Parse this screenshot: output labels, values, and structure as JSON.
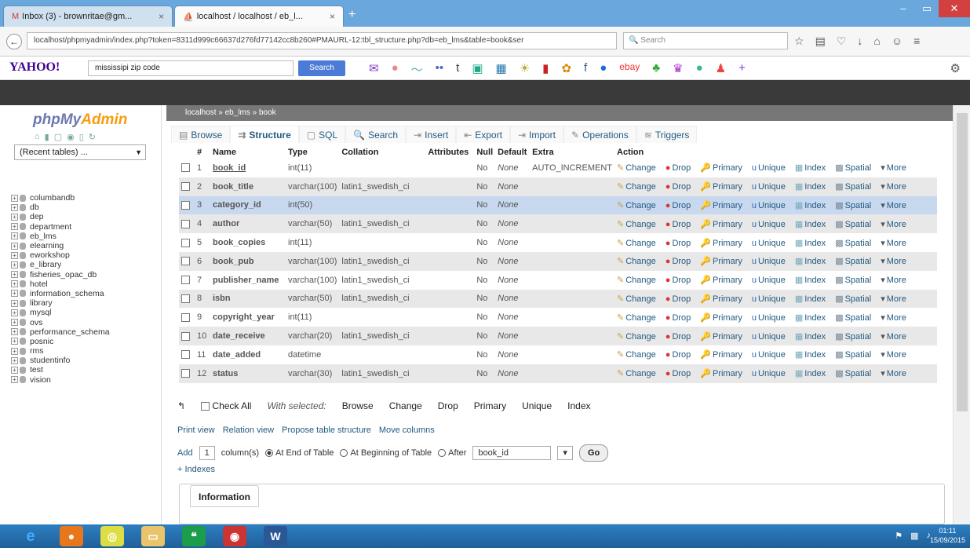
{
  "browser": {
    "tabs": [
      {
        "label": "Inbox (3) - brownritae@gm..."
      },
      {
        "label": "localhost / localhost / eb_l..."
      }
    ],
    "url": "localhost/phpmyadmin/index.php?token=8311d999c66637d276fd77142cc8b260#PMAURL-12:tbl_structure.php?db=eb_lms&table=book&ser",
    "search_placeholder": "Search"
  },
  "yahoo": {
    "logo": "YAHOO!",
    "query": "mississipi zip code",
    "search_button": "Search"
  },
  "sidebar": {
    "logo_php": "phpMy",
    "logo_admin": "Admin",
    "recent": "(Recent tables) ...",
    "databases": [
      "columbandb",
      "db",
      "dep",
      "department",
      "eb_lms",
      "elearning",
      "eworkshop",
      "e_library",
      "fisheries_opac_db",
      "hotel",
      "information_schema",
      "library",
      "mysql",
      "ovs",
      "performance_schema",
      "posnic",
      "rms",
      "studentinfo",
      "test",
      "vision"
    ]
  },
  "breadcrumb": "localhost » eb_lms » book",
  "tabs": [
    "Browse",
    "Structure",
    "SQL",
    "Search",
    "Insert",
    "Export",
    "Import",
    "Operations",
    "Triggers"
  ],
  "columns": {
    "hash": "#",
    "name": "Name",
    "type": "Type",
    "collation": "Collation",
    "attributes": "Attributes",
    "null": "Null",
    "default": "Default",
    "extra": "Extra",
    "action": "Action"
  },
  "rows": [
    {
      "n": "1",
      "name": "book_id",
      "type": "int(11)",
      "collation": "",
      "null": "No",
      "default": "None",
      "extra": "AUTO_INCREMENT"
    },
    {
      "n": "2",
      "name": "book_title",
      "type": "varchar(100)",
      "collation": "latin1_swedish_ci",
      "null": "No",
      "default": "None",
      "extra": ""
    },
    {
      "n": "3",
      "name": "category_id",
      "type": "int(50)",
      "collation": "",
      "null": "No",
      "default": "None",
      "extra": ""
    },
    {
      "n": "4",
      "name": "author",
      "type": "varchar(50)",
      "collation": "latin1_swedish_ci",
      "null": "No",
      "default": "None",
      "extra": ""
    },
    {
      "n": "5",
      "name": "book_copies",
      "type": "int(11)",
      "collation": "",
      "null": "No",
      "default": "None",
      "extra": ""
    },
    {
      "n": "6",
      "name": "book_pub",
      "type": "varchar(100)",
      "collation": "latin1_swedish_ci",
      "null": "No",
      "default": "None",
      "extra": ""
    },
    {
      "n": "7",
      "name": "publisher_name",
      "type": "varchar(100)",
      "collation": "latin1_swedish_ci",
      "null": "No",
      "default": "None",
      "extra": ""
    },
    {
      "n": "8",
      "name": "isbn",
      "type": "varchar(50)",
      "collation": "latin1_swedish_ci",
      "null": "No",
      "default": "None",
      "extra": ""
    },
    {
      "n": "9",
      "name": "copyright_year",
      "type": "int(11)",
      "collation": "",
      "null": "No",
      "default": "None",
      "extra": ""
    },
    {
      "n": "10",
      "name": "date_receive",
      "type": "varchar(20)",
      "collation": "latin1_swedish_ci",
      "null": "No",
      "default": "None",
      "extra": ""
    },
    {
      "n": "11",
      "name": "date_added",
      "type": "datetime",
      "collation": "",
      "null": "No",
      "default": "None",
      "extra": ""
    },
    {
      "n": "12",
      "name": "status",
      "type": "varchar(30)",
      "collation": "latin1_swedish_ci",
      "null": "No",
      "default": "None",
      "extra": ""
    }
  ],
  "actions": [
    "Change",
    "Drop",
    "Primary",
    "Unique",
    "Index",
    "Spatial",
    "More"
  ],
  "with_selected": {
    "check_all": "Check All",
    "label": "With selected:",
    "items": [
      "Browse",
      "Change",
      "Drop",
      "Primary",
      "Unique",
      "Index"
    ]
  },
  "links": [
    "Print view",
    "Relation view",
    "Propose table structure",
    "Move columns"
  ],
  "add": {
    "label": "Add",
    "count": "1",
    "cols": "column(s)",
    "opt1": "At End of Table",
    "opt2": "At Beginning of Table",
    "opt3": "After",
    "after_value": "book_id",
    "go": "Go"
  },
  "indexes": "+ Indexes",
  "information": "Information",
  "clock": {
    "time": "01:11",
    "date": "15/09/2015"
  }
}
